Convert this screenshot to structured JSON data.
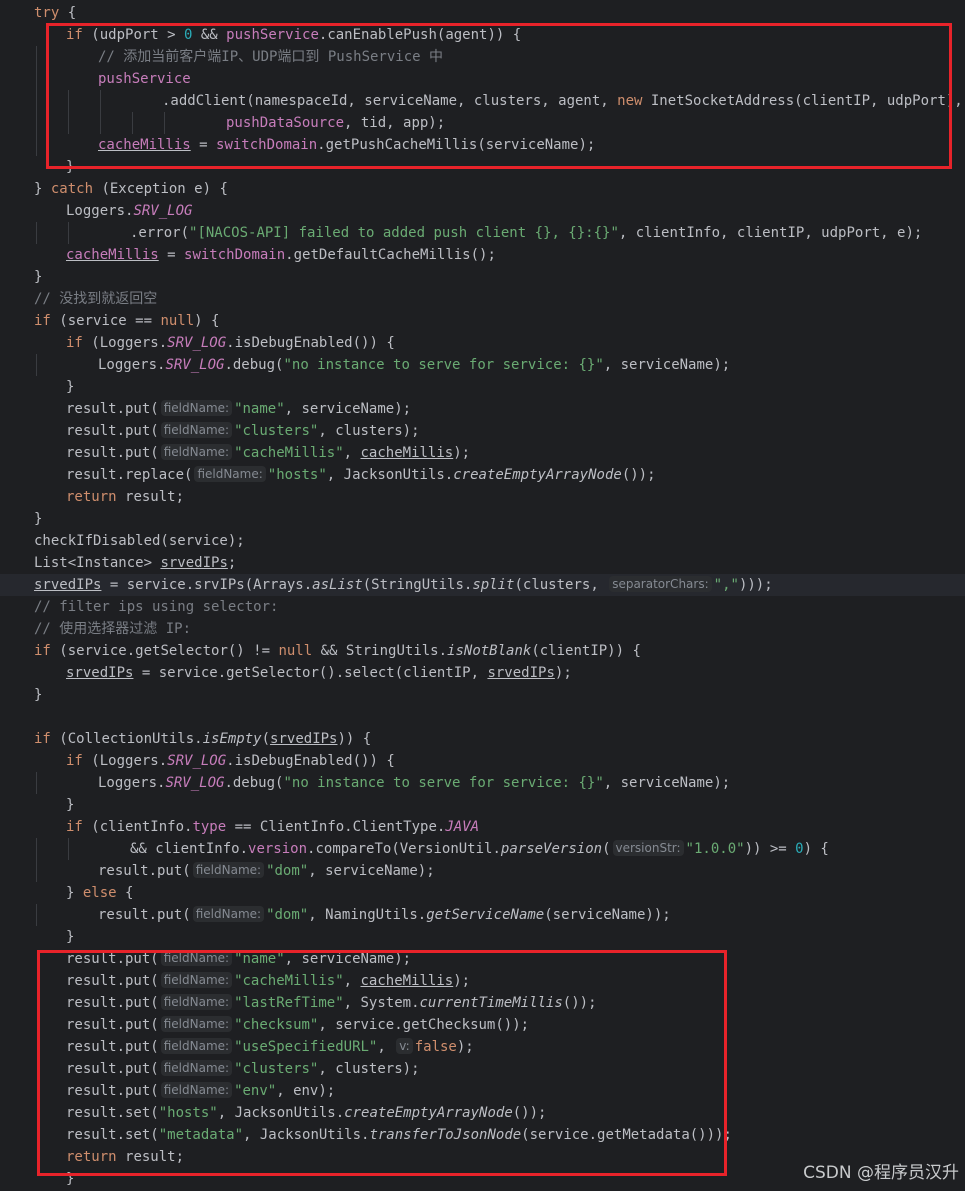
{
  "editor": {
    "language": "Java",
    "theme": "dark",
    "current_line_index": 26,
    "colors": {
      "background": "#1e1f22",
      "keyword": "#cf8e6d",
      "string": "#6aab73",
      "comment": "#7a7e85",
      "field": "#c77dbb",
      "number": "#2aacb8",
      "highlight_box": "#e8232a"
    }
  },
  "lines": [
    [
      [
        "kw",
        "try "
      ],
      [
        "t",
        "{"
      ]
    ],
    [
      [
        "kw",
        "if "
      ],
      [
        "t",
        "(udpPort > "
      ],
      [
        "num",
        "0"
      ],
      [
        "t",
        " && "
      ],
      [
        "fld",
        "pushService"
      ],
      [
        "t",
        ".canEnablePush(agent)) {"
      ]
    ],
    [
      [
        "cmt",
        "// 添加当前客户端IP、UDP端口到 PushService 中"
      ]
    ],
    [
      [
        "fld",
        "pushService"
      ]
    ],
    [
      [
        "t",
        ".addClient(namespaceId, serviceName, clusters, agent, "
      ],
      [
        "kw",
        "new "
      ],
      [
        "t",
        "InetSocketAddress(clientIP, udpPort),"
      ]
    ],
    [
      [
        "fld",
        "pushDataSource"
      ],
      [
        "t",
        ", tid, app);"
      ]
    ],
    [
      [
        "fld und",
        "cacheMillis"
      ],
      [
        "t",
        " = "
      ],
      [
        "fld",
        "switchDomain"
      ],
      [
        "t",
        ".getPushCacheMillis(serviceName);"
      ]
    ],
    [
      [
        "t",
        "}"
      ]
    ],
    [
      [
        "t",
        "} "
      ],
      [
        "kw",
        "catch "
      ],
      [
        "t",
        "(Exception e) {"
      ]
    ],
    [
      [
        "t",
        "Loggers."
      ],
      [
        "fld ital",
        "SRV_LOG"
      ]
    ],
    [
      [
        "t",
        ".error("
      ],
      [
        "str",
        "\"[NACOS-API] failed to added push client {}, {}:{}\""
      ],
      [
        "t",
        ", clientInfo, clientIP, udpPort, e);"
      ]
    ],
    [
      [
        "fld und",
        "cacheMillis"
      ],
      [
        "t",
        " = "
      ],
      [
        "fld",
        "switchDomain"
      ],
      [
        "t",
        ".getDefaultCacheMillis();"
      ]
    ],
    [
      [
        "t",
        "}"
      ]
    ],
    [
      [
        "cmt",
        "// 没找到就返回空"
      ]
    ],
    [
      [
        "kw",
        "if "
      ],
      [
        "t",
        "(service == "
      ],
      [
        "kw",
        "null"
      ],
      [
        "t",
        ") {"
      ]
    ],
    [
      [
        "kw",
        "if "
      ],
      [
        "t",
        "(Loggers."
      ],
      [
        "fld ital",
        "SRV_LOG"
      ],
      [
        "t",
        ".isDebugEnabled()) {"
      ]
    ],
    [
      [
        "t",
        "Loggers."
      ],
      [
        "fld ital",
        "SRV_LOG"
      ],
      [
        "t",
        ".debug("
      ],
      [
        "str",
        "\"no instance to serve for service: {}\""
      ],
      [
        "t",
        ", serviceName);"
      ]
    ],
    [
      [
        "t",
        "}"
      ]
    ],
    [
      [
        "t",
        "result.put("
      ],
      [
        "hint",
        "fieldName:"
      ],
      [
        "str",
        "\"name\""
      ],
      [
        "t",
        ", serviceName);"
      ]
    ],
    [
      [
        "t",
        "result.put("
      ],
      [
        "hint",
        "fieldName:"
      ],
      [
        "str",
        "\"clusters\""
      ],
      [
        "t",
        ", clusters);"
      ]
    ],
    [
      [
        "t",
        "result.put("
      ],
      [
        "hint",
        "fieldName:"
      ],
      [
        "str",
        "\"cacheMillis\""
      ],
      [
        "t",
        ", "
      ],
      [
        "t und",
        "cacheMillis"
      ],
      [
        "t",
        ");"
      ]
    ],
    [
      [
        "t",
        "result.replace("
      ],
      [
        "hint",
        "fieldName:"
      ],
      [
        "str",
        "\"hosts\""
      ],
      [
        "t",
        ", JacksonUtils."
      ],
      [
        "ital",
        "createEmptyArrayNode"
      ],
      [
        "t",
        "());"
      ]
    ],
    [
      [
        "kw",
        "return "
      ],
      [
        "t",
        "result;"
      ]
    ],
    [
      [
        "t",
        "}"
      ]
    ],
    [
      [
        "t",
        "checkIfDisabled(service);"
      ]
    ],
    [
      [
        "t",
        "List<Instance> "
      ],
      [
        "t und",
        "srvedIPs"
      ],
      [
        "t",
        ";"
      ]
    ],
    [
      [
        "t und",
        "srvedIPs"
      ],
      [
        "t",
        " = service.srvIPs(Arrays."
      ],
      [
        "ital",
        "asList"
      ],
      [
        "t",
        "(StringUtils."
      ],
      [
        "ital",
        "split"
      ],
      [
        "t",
        "(clusters, "
      ],
      [
        "hint",
        "separatorChars:"
      ],
      [
        "str",
        "\",\""
      ],
      [
        "t",
        ")));"
      ]
    ],
    [
      [
        "cmt",
        "// filter ips using selector:"
      ]
    ],
    [
      [
        "cmt",
        "// 使用选择器过滤 IP:"
      ]
    ],
    [
      [
        "kw",
        "if "
      ],
      [
        "t",
        "(service.getSelector() != "
      ],
      [
        "kw",
        "null"
      ],
      [
        "t",
        " && StringUtils."
      ],
      [
        "ital",
        "isNotBlank"
      ],
      [
        "t",
        "(clientIP)) {"
      ]
    ],
    [
      [
        "t und",
        "srvedIPs"
      ],
      [
        "t",
        " = service.getSelector().select(clientIP, "
      ],
      [
        "t und",
        "srvedIPs"
      ],
      [
        "t",
        ");"
      ]
    ],
    [
      [
        "t",
        "}"
      ]
    ],
    [],
    [
      [
        "kw",
        "if "
      ],
      [
        "t",
        "(CollectionUtils."
      ],
      [
        "ital",
        "isEmpty"
      ],
      [
        "t",
        "("
      ],
      [
        "t und",
        "srvedIPs"
      ],
      [
        "t",
        ")) {"
      ]
    ],
    [
      [
        "kw",
        "if "
      ],
      [
        "t",
        "(Loggers."
      ],
      [
        "fld ital",
        "SRV_LOG"
      ],
      [
        "t",
        ".isDebugEnabled()) {"
      ]
    ],
    [
      [
        "t",
        "Loggers."
      ],
      [
        "fld ital",
        "SRV_LOG"
      ],
      [
        "t",
        ".debug("
      ],
      [
        "str",
        "\"no instance to serve for service: {}\""
      ],
      [
        "t",
        ", serviceName);"
      ]
    ],
    [
      [
        "t",
        "}"
      ]
    ],
    [
      [
        "kw",
        "if "
      ],
      [
        "t",
        "(clientInfo."
      ],
      [
        "fld",
        "type"
      ],
      [
        "t",
        " == ClientInfo.ClientType."
      ],
      [
        "fld ital",
        "JAVA"
      ]
    ],
    [
      [
        "t",
        "&& clientInfo."
      ],
      [
        "fld",
        "version"
      ],
      [
        "t",
        ".compareTo(VersionUtil."
      ],
      [
        "ital",
        "parseVersion"
      ],
      [
        "t",
        "("
      ],
      [
        "hint",
        "versionStr:"
      ],
      [
        "str",
        "\"1.0.0\""
      ],
      [
        "t",
        ")) >= "
      ],
      [
        "num",
        "0"
      ],
      [
        "t",
        ") {"
      ]
    ],
    [
      [
        "t",
        "result.put("
      ],
      [
        "hint",
        "fieldName:"
      ],
      [
        "str",
        "\"dom\""
      ],
      [
        "t",
        ", serviceName);"
      ]
    ],
    [
      [
        "t",
        "} "
      ],
      [
        "kw",
        "else "
      ],
      [
        "t",
        "{"
      ]
    ],
    [
      [
        "t",
        "result.put("
      ],
      [
        "hint",
        "fieldName:"
      ],
      [
        "str",
        "\"dom\""
      ],
      [
        "t",
        ", NamingUtils."
      ],
      [
        "ital",
        "getServiceName"
      ],
      [
        "t",
        "(serviceName));"
      ]
    ],
    [
      [
        "t",
        "}"
      ]
    ],
    [
      [
        "t",
        "result.put("
      ],
      [
        "hint",
        "fieldName:"
      ],
      [
        "str",
        "\"name\""
      ],
      [
        "t",
        ", serviceName);"
      ]
    ],
    [
      [
        "t",
        "result.put("
      ],
      [
        "hint",
        "fieldName:"
      ],
      [
        "str",
        "\"cacheMillis\""
      ],
      [
        "t",
        ", "
      ],
      [
        "t und",
        "cacheMillis"
      ],
      [
        "t",
        ");"
      ]
    ],
    [
      [
        "t",
        "result.put("
      ],
      [
        "hint",
        "fieldName:"
      ],
      [
        "str",
        "\"lastRefTime\""
      ],
      [
        "t",
        ", System."
      ],
      [
        "ital",
        "currentTimeMillis"
      ],
      [
        "t",
        "());"
      ]
    ],
    [
      [
        "t",
        "result.put("
      ],
      [
        "hint",
        "fieldName:"
      ],
      [
        "str",
        "\"checksum\""
      ],
      [
        "t",
        ", service.getChecksum());"
      ]
    ],
    [
      [
        "t",
        "result.put("
      ],
      [
        "hint",
        "fieldName:"
      ],
      [
        "str",
        "\"useSpecifiedURL\""
      ],
      [
        "t",
        ", "
      ],
      [
        "hint",
        "v:"
      ],
      [
        "kw",
        "false"
      ],
      [
        "t",
        ");"
      ]
    ],
    [
      [
        "t",
        "result.put("
      ],
      [
        "hint",
        "fieldName:"
      ],
      [
        "str",
        "\"clusters\""
      ],
      [
        "t",
        ", clusters);"
      ]
    ],
    [
      [
        "t",
        "result.put("
      ],
      [
        "hint",
        "fieldName:"
      ],
      [
        "str",
        "\"env\""
      ],
      [
        "t",
        ", env);"
      ]
    ],
    [
      [
        "t",
        "result.set("
      ],
      [
        "str",
        "\"hosts\""
      ],
      [
        "t",
        ", JacksonUtils."
      ],
      [
        "ital",
        "createEmptyArrayNode"
      ],
      [
        "t",
        "());"
      ]
    ],
    [
      [
        "t",
        "result.set("
      ],
      [
        "str",
        "\"metadata\""
      ],
      [
        "t",
        ", JacksonUtils."
      ],
      [
        "ital",
        "transferToJsonNode"
      ],
      [
        "t",
        "(service.getMetadata()));"
      ]
    ],
    [
      [
        "kw",
        "return "
      ],
      [
        "t",
        "result;"
      ]
    ],
    [
      [
        "t",
        "}"
      ]
    ]
  ],
  "watermark": "CSDN @程序员汉升"
}
